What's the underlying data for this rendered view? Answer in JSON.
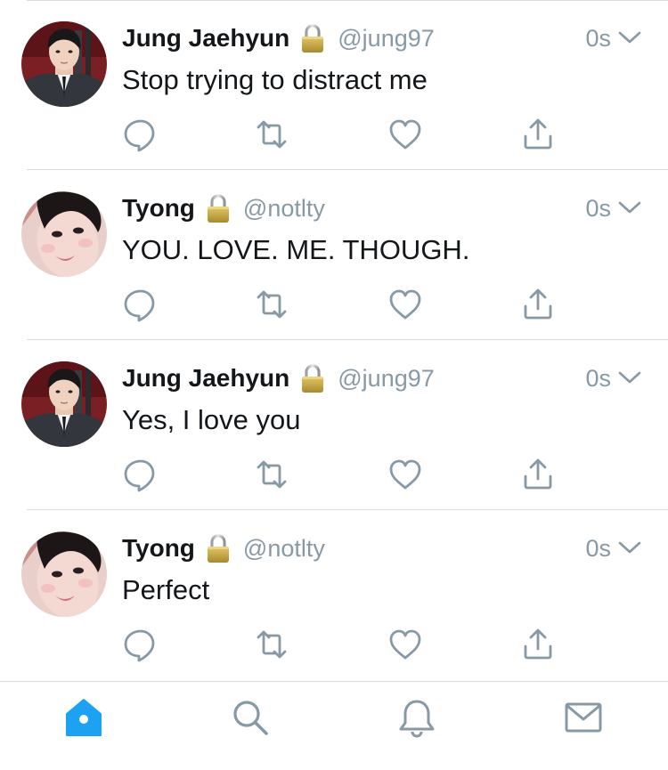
{
  "colors": {
    "accent": "#1da1f2",
    "secondary_text": "#8899a6",
    "icon_gray": "#8899a6",
    "divider": "#dadde0"
  },
  "tweets": [
    {
      "display_name": "Jung Jaehyun",
      "protected_icon": "lock-icon",
      "handle": "@jung97",
      "time": "0s",
      "text": "Stop trying to distract me",
      "avatar": "avatar-jaehyun"
    },
    {
      "display_name": "Tyong",
      "protected_icon": "lock-icon",
      "handle": "@notlty",
      "time": "0s",
      "text": "YOU. LOVE. ME. THOUGH.",
      "avatar": "avatar-tyong"
    },
    {
      "display_name": "Jung Jaehyun",
      "protected_icon": "lock-icon",
      "handle": "@jung97",
      "time": "0s",
      "text": "Yes, I love you",
      "avatar": "avatar-jaehyun"
    },
    {
      "display_name": "Tyong",
      "protected_icon": "lock-icon",
      "handle": "@notlty",
      "time": "0s",
      "text": "Perfect",
      "avatar": "avatar-tyong"
    }
  ],
  "actions": [
    "reply-icon",
    "retweet-icon",
    "like-icon",
    "share-icon"
  ],
  "tabbar": {
    "active": "home",
    "tabs": [
      "home-icon",
      "search-icon",
      "notifications-icon",
      "messages-icon"
    ]
  }
}
